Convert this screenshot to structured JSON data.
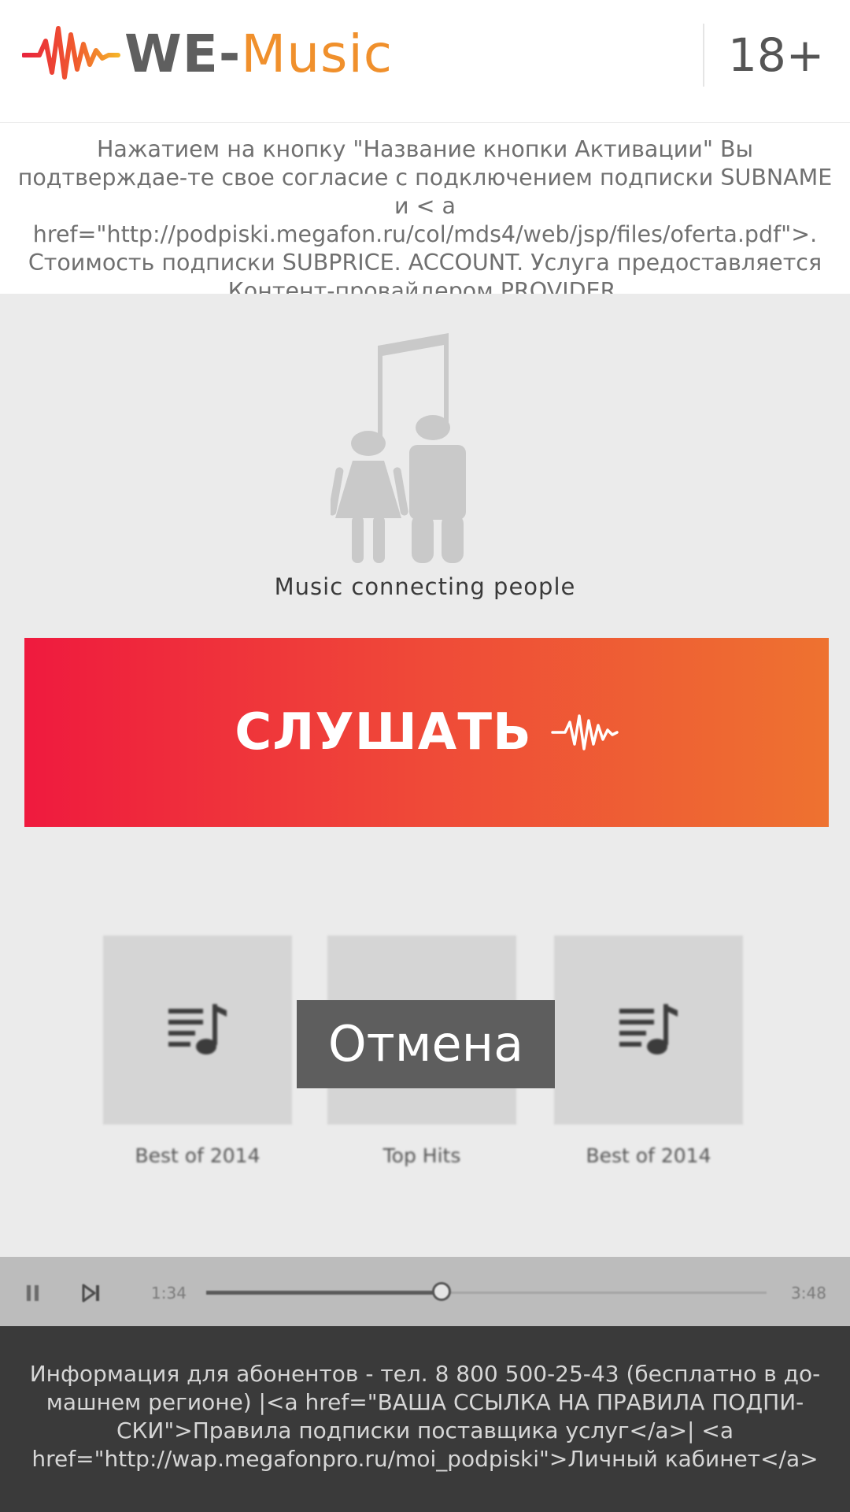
{
  "header": {
    "logo_we": "WE-",
    "logo_music": "Music",
    "age_rating": "18+"
  },
  "offer": {
    "text": "Нажатием на кнопку \"Название кнопки Активации\" Вы подтверждае-те свое согласие с подключением подписки SUBNAME и < a href=\"http://podpiski.megafon.ru/col/mds4/web/jsp/files/oferta.pdf\">. Стоимость подписки SUBPRICE. ACCOUNT. Услуга предоставляется Контент-провайдером PROVIDER."
  },
  "main": {
    "tagline": "Music connecting people",
    "listen_label": "СЛУШАТЬ",
    "cancel_label": "Отмена",
    "albums": [
      {
        "label": "Best of 2014",
        "icon": "playlist-icon"
      },
      {
        "label": "Top Hits",
        "icon": "playlist-icon"
      },
      {
        "label": "Best of 2014",
        "icon": "playlist-icon"
      }
    ]
  },
  "player": {
    "current_time": "1:34",
    "total_time": "3:48",
    "progress": 0.42
  },
  "footer": {
    "text": "Информация для абонентов - тел. 8 800 500-25-43 (бесплатно в до-машнем регионе) |<a href=\"ВАША ССЫЛКА НА ПРАВИЛА ПОДПИ-СКИ\">Правила подписки поставщика услуг</a>| <a href=\"http://wap.megafonpro.ru/moi_podpiski\">Личный кабинет</a>"
  },
  "colors": {
    "accent_orange": "#f0902c",
    "button_gradient_start": "#ef1a3e",
    "button_gradient_end": "#ee7230",
    "main_background": "#ebebeb",
    "footer_background": "#3a3a3a"
  }
}
